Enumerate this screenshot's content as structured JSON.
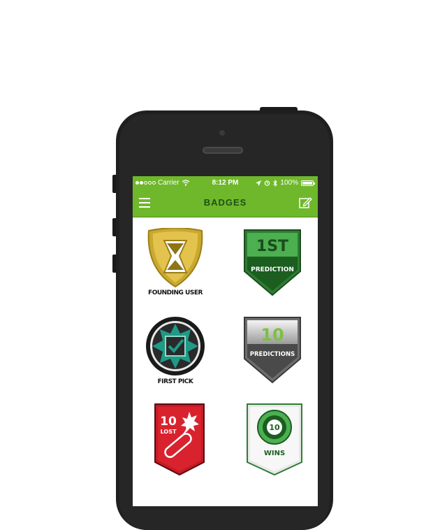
{
  "status_bar": {
    "carrier": "Carrier",
    "time": "8:12 PM",
    "battery": "100%",
    "battery_level": 1.0
  },
  "nav": {
    "title": "BADGES",
    "left_icon": "hamburger-menu-icon",
    "right_icon": "compose-icon"
  },
  "badges": [
    {
      "label": "FOUNDING USER",
      "icon": "hourglass-shield-icon",
      "color": "#c9a92e"
    },
    {
      "label": "",
      "top": "1ST",
      "bottom": "PREDICTION",
      "icon": "green-shield-icon",
      "color": "#2e7d32"
    },
    {
      "label": "FIRST PICK",
      "icon": "checkbox-starburst-icon",
      "color": "#1f9a86"
    },
    {
      "label": "",
      "top": "10",
      "bottom": "PREDICTIONS",
      "icon": "silver-shield-icon",
      "color": "#8a8a8a"
    },
    {
      "label": "",
      "top": "10",
      "bottom": "LOST",
      "icon": "dynamite-pennant-icon",
      "color": "#c41a26"
    },
    {
      "label": "",
      "top": "10",
      "bottom": "WINS",
      "icon": "target-pennant-icon",
      "color": "#4caf50"
    }
  ],
  "colors": {
    "accent": "#6fb82b",
    "title_text": "#1f4f16"
  }
}
